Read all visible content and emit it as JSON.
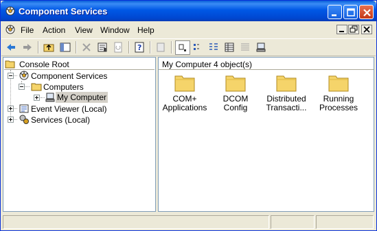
{
  "window": {
    "title": "Component Services",
    "title_icon": "component-services-icon"
  },
  "menu": {
    "items": [
      "File",
      "Action",
      "View",
      "Window",
      "Help"
    ]
  },
  "toolbar": {
    "buttons": [
      "back-icon",
      "forward-icon",
      "up-folder-icon",
      "show-hide-tree-icon",
      "delete-icon",
      "properties-icon",
      "refresh-icon",
      "help-icon",
      "new-icon",
      "large-icons-view-icon",
      "small-icons-view-icon",
      "list-view-icon",
      "detail-view-icon",
      "properties-view-icon",
      "computer-view-icon"
    ]
  },
  "tree": {
    "header": "Console Root",
    "items": [
      {
        "label": "Component Services",
        "icon": "component-services-icon"
      },
      {
        "label": "Computers",
        "icon": "folder-icon"
      },
      {
        "label": "My Computer",
        "icon": "computer-icon"
      },
      {
        "label": "Event Viewer (Local)",
        "icon": "event-viewer-icon"
      },
      {
        "label": "Services (Local)",
        "icon": "services-icon"
      }
    ]
  },
  "content": {
    "location": "My Computer",
    "count": "4 object(s)",
    "items": [
      {
        "line1": "COM+",
        "line2": "Applications"
      },
      {
        "line1": "DCOM Config",
        "line2": ""
      },
      {
        "line1": "Distributed",
        "line2": "Transacti..."
      },
      {
        "line1": "Running",
        "line2": "Processes"
      }
    ]
  },
  "colors": {
    "titlebar": "#0058e6",
    "face": "#ece9d8",
    "folder": "#f5d46a"
  }
}
